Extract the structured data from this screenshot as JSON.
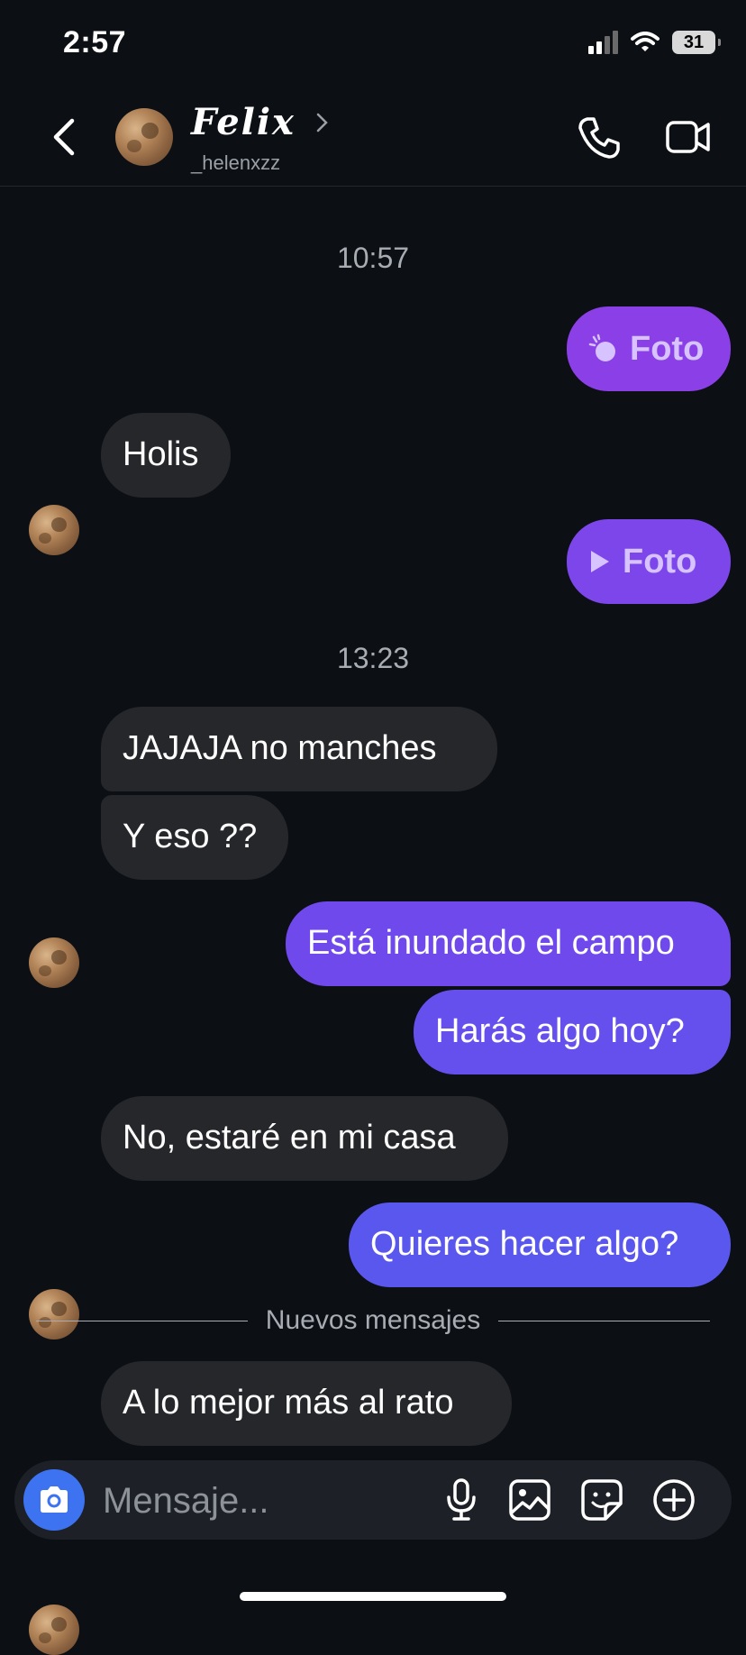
{
  "status_bar": {
    "time": "2:57",
    "battery": "31",
    "icons": [
      "signal-icon",
      "wifi-icon",
      "battery-icon"
    ]
  },
  "header": {
    "back_icon": "chevron-left-icon",
    "name": "Felix",
    "username": "_helenxzz",
    "chevron_icon": "chevron-right-icon",
    "call_icon": "phone-icon",
    "video_icon": "video-camera-icon"
  },
  "conversation": {
    "timestamp_1": "10:57",
    "timestamp_2": "13:23",
    "messages": [
      {
        "from": "me",
        "text": "Foto",
        "kind": "photo",
        "icon": "view-once-icon"
      },
      {
        "from": "them",
        "text": "Holis"
      },
      {
        "from": "me",
        "text": "Foto",
        "kind": "photo",
        "icon": "play-icon"
      },
      {
        "from": "them",
        "text": "JAJAJA no manches"
      },
      {
        "from": "them",
        "text": "Y eso ??"
      },
      {
        "from": "me",
        "text": "Está inundado el campo"
      },
      {
        "from": "me",
        "text": "Harás algo hoy?"
      },
      {
        "from": "them",
        "text": "No, estaré en mi casa"
      },
      {
        "from": "me",
        "text": "Quieres hacer algo?"
      },
      {
        "from": "them",
        "text": "A lo mejor más al rato"
      }
    ],
    "new_messages_divider": "Nuevos mensajes"
  },
  "composer": {
    "placeholder": "Mensaje...",
    "icons": [
      "camera-icon",
      "microphone-icon",
      "gallery-icon",
      "sticker-icon",
      "add-icon"
    ]
  },
  "colors": {
    "background": "#0c0f14",
    "incoming_bubble": "#25272b",
    "outgoing_purple": "#8b3fe6",
    "outgoing_violet": "#7048ec",
    "outgoing_blue": "#5a57ef",
    "camera_button": "#3d73f1"
  }
}
